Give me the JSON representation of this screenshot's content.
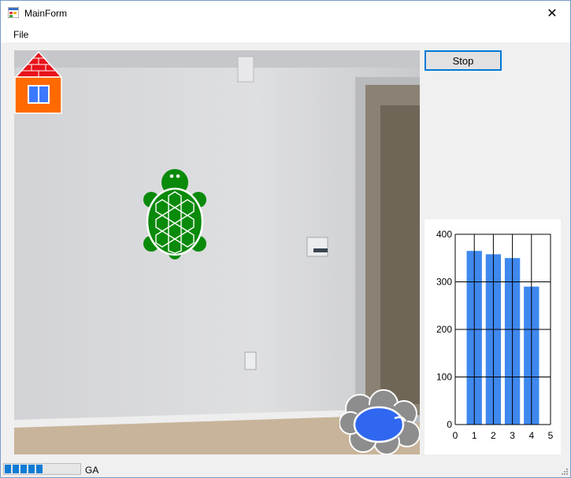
{
  "window": {
    "title": "MainForm",
    "close_glyph": "✕"
  },
  "menu": {
    "items": [
      "File"
    ]
  },
  "controls": {
    "stop_label": "Stop"
  },
  "icons": {
    "app": "app-icon",
    "close": "close-icon",
    "house": "house-icon",
    "turtle": "turtle-icon",
    "pond": "pond-icon",
    "grip": "resize-grip-icon"
  },
  "status": {
    "progress": 0.5,
    "text": "GA"
  },
  "colors": {
    "bar": "#3f88ee",
    "turtle": "#0a8a0a",
    "house_roof": "#e8121a",
    "house_wall": "#ff6a00",
    "window_pane": "#3b79ff",
    "pond_water": "#2f67f0",
    "pond_cloud": "#8d8d8d",
    "progress": "#0f7bd6"
  },
  "chart_data": {
    "type": "bar",
    "categories": [
      1,
      2,
      3,
      4
    ],
    "values": [
      365,
      358,
      350,
      290
    ],
    "xlim": [
      0,
      5
    ],
    "ylim": [
      0,
      400
    ],
    "x_ticks": [
      "0",
      "1",
      "2",
      "3",
      "4",
      "5"
    ],
    "y_ticks": [
      "0",
      "100",
      "200",
      "300",
      "400"
    ],
    "grid": true,
    "title": "",
    "xlabel": "",
    "ylabel": ""
  }
}
